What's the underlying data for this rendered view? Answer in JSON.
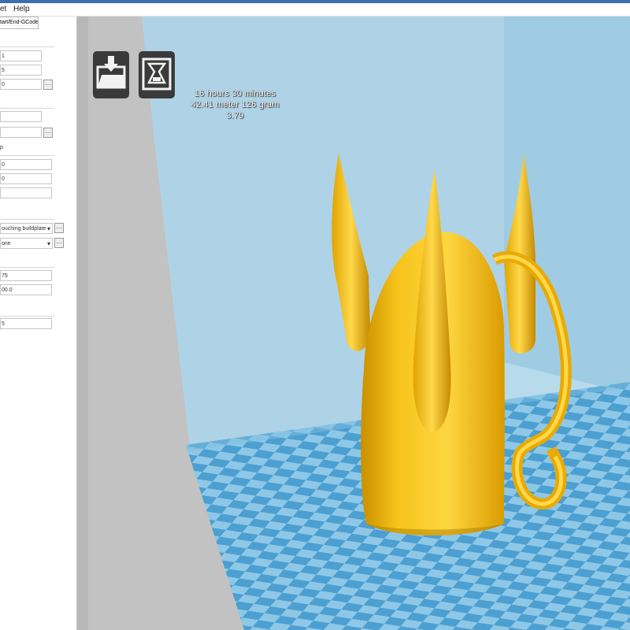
{
  "menubar": {
    "items": [
      "et",
      "Help"
    ]
  },
  "sidebar": {
    "tab_label": "tart/End-GCode",
    "fields": [
      "1",
      "5",
      "0",
      "",
      "",
      "",
      "0",
      "0",
      "",
      "ouching buildplate",
      "one",
      "75",
      "00.0",
      "5"
    ],
    "section_label": "p"
  },
  "toolbar": {
    "load_icon": "load-model-icon",
    "print_icon": "save-toolpath-icon"
  },
  "print_info": {
    "time": "16 hours 30 minutes",
    "material": "42.41 meter 126 gram",
    "cost": "3.79"
  },
  "colors": {
    "model": "#f6c31a",
    "bed_light": "#8ec8e6",
    "bed_dark": "#4c9fd1",
    "wall": "#aed3e6",
    "floor_gray": "#c2c2c2"
  }
}
